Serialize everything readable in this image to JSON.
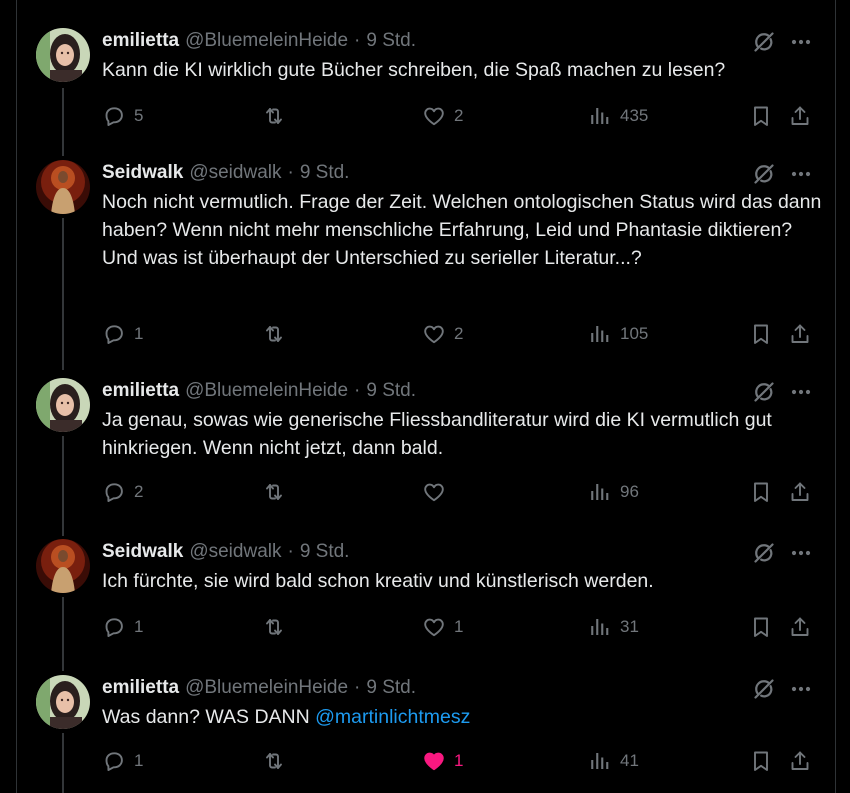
{
  "colors": {
    "background": "#000000",
    "text": "#e7e9ea",
    "secondary": "#71767b",
    "mention": "#1d9bf0",
    "like_active": "#f91880",
    "thread_line": "#333639"
  },
  "tweets": [
    {
      "name": "emilietta",
      "handle": "@BluemeleinHeide",
      "separator": "·",
      "time": "9 Std.",
      "text": "Kann die KI wirklich gute Bücher schreiben, die Spaß machen zu lesen?",
      "mention": "",
      "replies": "5",
      "retweets": "",
      "likes": "2",
      "liked": false,
      "views": "435"
    },
    {
      "name": "Seidwalk",
      "handle": "@seidwalk",
      "separator": "·",
      "time": "9 Std.",
      "text": "Noch nicht vermutlich. Frage der Zeit. Welchen ontologischen Status wird das dann haben? Wenn nicht mehr menschliche Erfahrung, Leid und Phantasie diktieren? Und was ist überhaupt der Unterschied zu serieller Literatur...?",
      "mention": "",
      "replies": "1",
      "retweets": "",
      "likes": "2",
      "liked": false,
      "views": "105"
    },
    {
      "name": "emilietta",
      "handle": "@BluemeleinHeide",
      "separator": "·",
      "time": "9 Std.",
      "text": "Ja genau, sowas wie generische Fliessbandliteratur wird die KI vermutlich gut hinkriegen. Wenn nicht jetzt, dann bald.",
      "mention": "",
      "replies": "2",
      "retweets": "",
      "likes": "",
      "liked": false,
      "views": "96"
    },
    {
      "name": "Seidwalk",
      "handle": "@seidwalk",
      "separator": "·",
      "time": "9 Std.",
      "text": "Ich fürchte, sie wird bald schon kreativ und künstlerisch werden.",
      "mention": "",
      "replies": "1",
      "retweets": "",
      "likes": "1",
      "liked": false,
      "views": "31"
    },
    {
      "name": "emilietta",
      "handle": "@BluemeleinHeide",
      "separator": "·",
      "time": "9 Std.",
      "text": "Was dann? WAS DANN ",
      "mention": "@martinlichtmesz",
      "replies": "1",
      "retweets": "",
      "likes": "1",
      "liked": true,
      "views": "41"
    }
  ]
}
